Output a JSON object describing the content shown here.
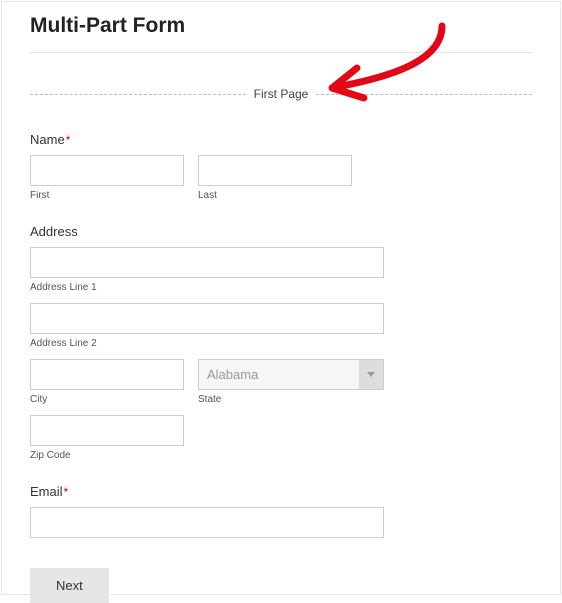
{
  "title": "Multi-Part Form",
  "divider_label": "First Page",
  "name": {
    "label": "Name",
    "required": "*",
    "first_value": "",
    "first_sub": "First",
    "last_value": "",
    "last_sub": "Last"
  },
  "address": {
    "label": "Address",
    "line1_value": "",
    "line1_sub": "Address Line 1",
    "line2_value": "",
    "line2_sub": "Address Line 2",
    "city_value": "",
    "city_sub": "City",
    "state_selected": "Alabama",
    "state_sub": "State",
    "zip_value": "",
    "zip_sub": "Zip Code"
  },
  "email": {
    "label": "Email",
    "required": "*",
    "value": ""
  },
  "next_btn": "Next",
  "annotation_color": "#e30613"
}
